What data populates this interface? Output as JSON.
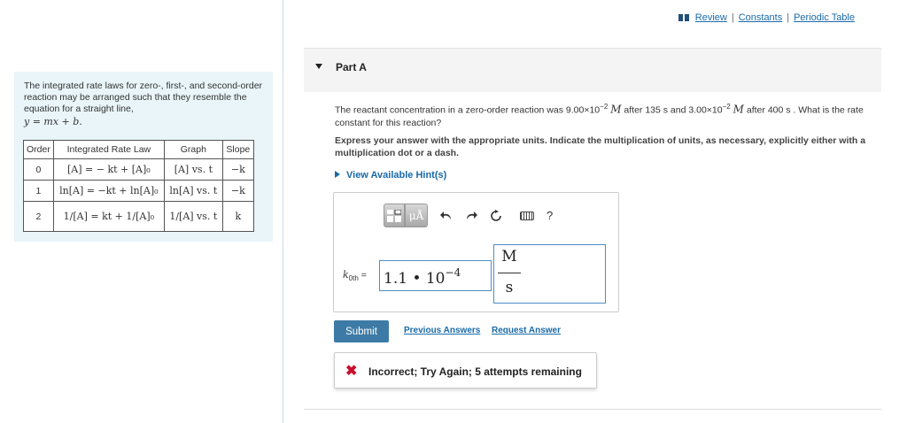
{
  "top_links": {
    "review": "Review",
    "constants": "Constants",
    "periodic_table": "Periodic Table",
    "separator": "|"
  },
  "info_panel": {
    "intro": "The integrated rate laws for zero-, first-, and second-order reaction may be arranged such that they resemble the equation for a straight line,",
    "line_equation": "y = mx + b.",
    "table": {
      "headers": [
        "Order",
        "Integrated Rate Law",
        "Graph",
        "Slope"
      ],
      "rows": [
        {
          "order": "0",
          "law": "[A] = − kt + [A]₀",
          "graph": "[A] vs. t",
          "slope": "−k"
        },
        {
          "order": "1",
          "law": "ln[A] = −kt + ln[A]₀",
          "graph": "ln[A] vs. t",
          "slope": "−k"
        },
        {
          "order": "2",
          "law": "1/[A] = kt + 1/[A]₀",
          "graph": "1/[A] vs. t",
          "slope": "k"
        }
      ]
    }
  },
  "part": {
    "title": "Part A"
  },
  "question": {
    "text_1": "The reactant concentration in a zero-order reaction was 9.00×10",
    "exp_1": "−2",
    "unit_1": "M",
    "text_2": " after 135 s and 3.00×10",
    "exp_2": "−2",
    "unit_2": "M",
    "text_3": " after 400 s . What is the rate constant for this reaction?"
  },
  "instruction": "Express your answer with the appropriate units. Indicate the multiplication of units, as necessary, explicitly either with a multiplication dot or a dash.",
  "hint_label": "View Available Hint(s)",
  "answer": {
    "label_var": "k",
    "label_sub": "0th",
    "label_eq": "=",
    "value_base": "1.1 • 10",
    "value_exp": "−4",
    "unit_numerator": "M",
    "unit_denominator": "s",
    "toolbar": {
      "template_icon": "matrix-template-icon",
      "units_label": "μÅ",
      "help_label": "?"
    }
  },
  "actions": {
    "submit": "Submit",
    "previous_answers": "Previous Answers",
    "request_answer": "Request Answer"
  },
  "feedback": {
    "icon": "✖",
    "message": "Incorrect; Try Again; 5 attempts remaining",
    "color": "#c8102e"
  }
}
